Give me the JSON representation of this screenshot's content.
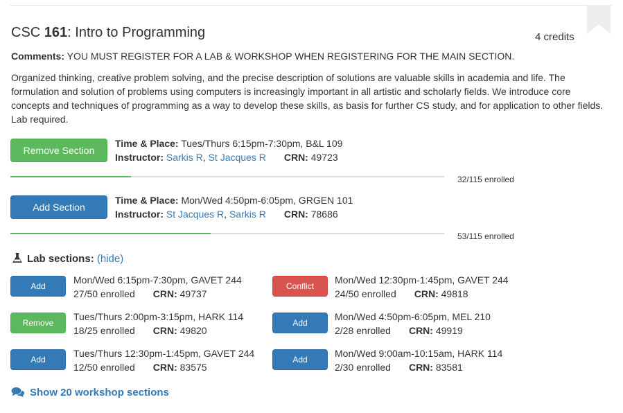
{
  "course": {
    "dept": "CSC",
    "number": "161",
    "title_suffix": ": Intro to Programming",
    "credits": "4 credits",
    "comments_label": "Comments:",
    "comments_text": "YOU MUST REGISTER FOR A LAB & WORKSHOP WHEN REGISTERING FOR THE MAIN SECTION.",
    "description": "Organized thinking, creative problem solving, and the precise description of solutions are valuable skills in academia and life. The formulation and solution of problems using computers is increasingly important in all artistic and scholarly fields. We introduce core concepts and techniques of programming as a way to develop these skills, as basis for further CS study, and for application to other fields. Lab required."
  },
  "labels": {
    "time_place": "Time & Place:",
    "instructor": "Instructor:",
    "crn": "CRN:",
    "comma": ", "
  },
  "colors": {
    "green": "#5cb85c",
    "blue": "#337ab7",
    "red": "#d9534f"
  },
  "sections": [
    {
      "button": "Remove Section",
      "time_place": "Tues/Thurs 6:15pm-7:30pm, B&L 109",
      "instructors": [
        "Sarkis R",
        "St Jacques R"
      ],
      "crn": "49723",
      "enrolled": "32/115 enrolled",
      "fill_fraction": 0.278
    },
    {
      "button": "Add Section",
      "time_place": "Mon/Wed 4:50pm-6:05pm, GRGEN 101",
      "instructors": [
        "St Jacques R",
        "Sarkis R"
      ],
      "crn": "78686",
      "enrolled": "53/115 enrolled",
      "fill_fraction": 0.461
    }
  ],
  "labs": {
    "header": "Lab sections:",
    "hide_link": "(hide)",
    "items": [
      {
        "button": "Add",
        "schedule": "Mon/Wed 6:15pm-7:30pm, GAVET 244",
        "enrolled": "27/50 enrolled",
        "crn": "49737"
      },
      {
        "button": "Conflict",
        "schedule": "Mon/Wed 12:30pm-1:45pm, GAVET 244",
        "enrolled": "24/50 enrolled",
        "crn": "49818"
      },
      {
        "button": "Remove",
        "schedule": "Tues/Thurs 2:00pm-3:15pm, HARK 114",
        "enrolled": "18/25 enrolled",
        "crn": "49820"
      },
      {
        "button": "Add",
        "schedule": "Mon/Wed 4:50pm-6:05pm, MEL 210",
        "enrolled": "2/28 enrolled",
        "crn": "49919"
      },
      {
        "button": "Add",
        "schedule": "Tues/Thurs 12:30pm-1:45pm, GAVET 244",
        "enrolled": "12/50 enrolled",
        "crn": "83575"
      },
      {
        "button": "Add",
        "schedule": "Mon/Wed 9:00am-10:15am, HARK 114",
        "enrolled": "2/30 enrolled",
        "crn": "83581"
      }
    ]
  },
  "workshop_link": "Show 20 workshop sections",
  "icons": {
    "bookmark": "bookmark-icon",
    "flask": "flask-icon",
    "comments": "comments-icon"
  }
}
